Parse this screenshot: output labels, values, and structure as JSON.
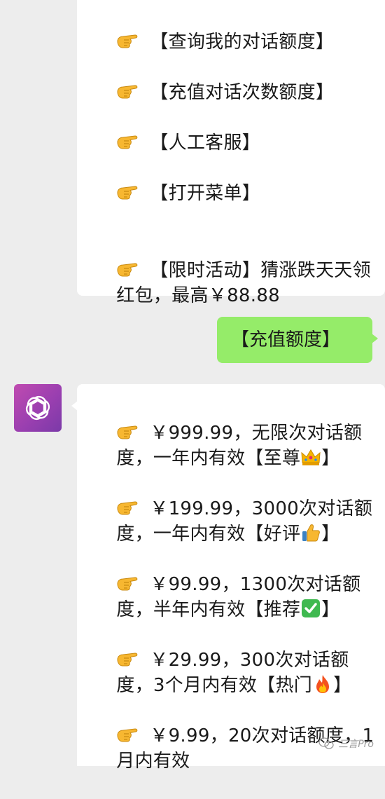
{
  "messages_top": {
    "items": [
      "【查询我的对话额度】",
      "【充值对话次数额度】",
      "【人工客服】",
      "【打开菜单】"
    ],
    "promo_line1": "【限时活动】猜涨跌天天领",
    "promo_line2": "红包，最高￥88.88"
  },
  "user_message": {
    "text": "【充值额度】"
  },
  "plans": [
    {
      "line1": "￥999.99，无限次对话额",
      "line2": "度，一年内有效【至尊",
      "badge_icon": "crown-emoji",
      "line2_end": "】"
    },
    {
      "line1": "￥199.99，3000次对话额",
      "line2": "度，一年内有效【好评",
      "badge_icon": "thumbs-up-emoji",
      "line2_end": "】"
    },
    {
      "line1": "￥99.99，1300次对话额",
      "line2": "度，半年内有效【推荐",
      "badge_icon": "check-mark-emoji",
      "line2_end": "】"
    },
    {
      "line1": "￥29.99，300次对话额",
      "line2": "度，3个月内有效【热门",
      "badge_icon": "fire-emoji",
      "line2_end": "】"
    },
    {
      "line1": "￥9.99，20次对话额度，1",
      "line2": "月内有效",
      "badge_icon": "",
      "line2_end": ""
    }
  ],
  "icons": {
    "pointing_hand": "backhand-index-pointing-right-emoji",
    "avatar": "openai-logo-icon"
  },
  "colors": {
    "background": "#ededed",
    "bubble_white": "#ffffff",
    "bubble_green": "#95ec69",
    "avatar_gradient_start": "#c04bb0",
    "avatar_gradient_end": "#7b3aa8"
  },
  "watermark": {
    "text": "三言Pro"
  }
}
